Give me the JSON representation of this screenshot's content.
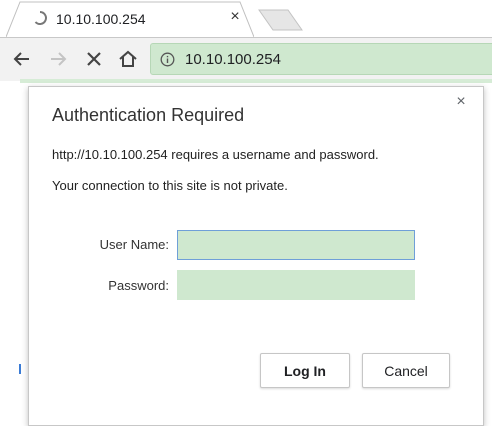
{
  "browser": {
    "tab": {
      "title": "10.10.100.254",
      "close_symbol": "×"
    },
    "new_tab_icon": "new-tab-icon",
    "toolbar": {
      "back_icon": "back-arrow-icon",
      "forward_icon": "forward-arrow-icon",
      "stop_icon": "stop-icon",
      "home_icon": "home-icon"
    },
    "omnibox": {
      "url": "10.10.100.254",
      "info_icon": "info-icon"
    },
    "accent_color": "#cfe8cf"
  },
  "dialog": {
    "title": "Authentication Required",
    "message_1": "http://10.10.100.254 requires a username and password.",
    "message_2": "Your connection to this site is not private.",
    "close_symbol": "×",
    "username_label": "User Name:",
    "username_value": "",
    "password_label": "Password:",
    "password_value": "",
    "login_label": "Log In",
    "cancel_label": "Cancel"
  }
}
